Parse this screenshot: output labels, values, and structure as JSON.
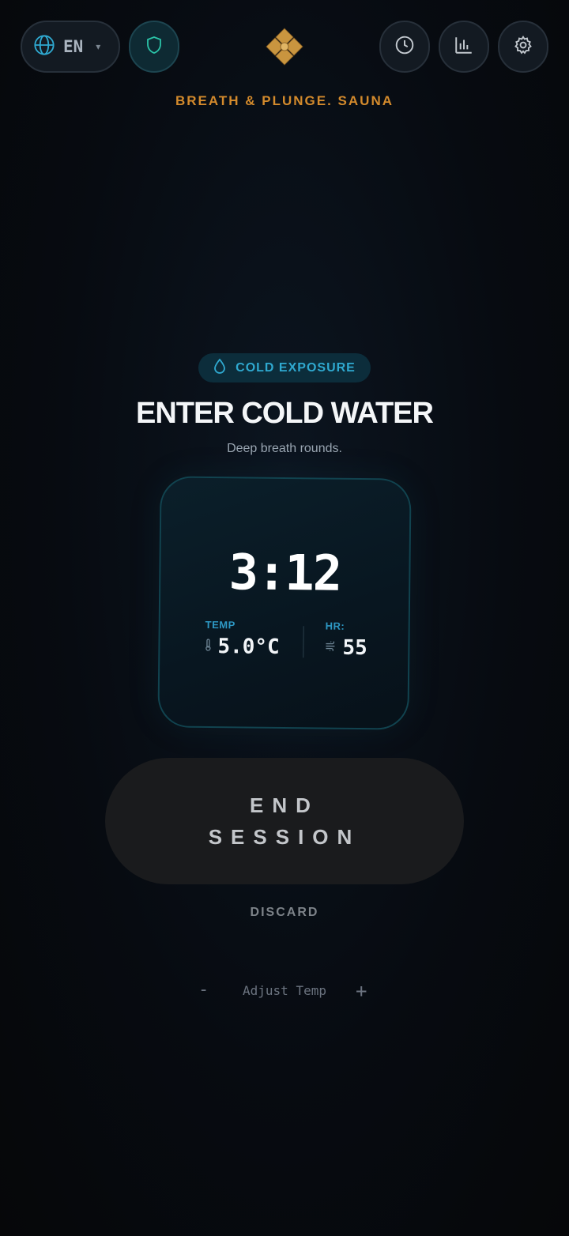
{
  "header": {
    "language": {
      "code": "EN",
      "icon": "globe-icon",
      "caret": "▾"
    },
    "shield_icon": "shield-icon",
    "logo_icon": "ornate-logo",
    "history_icon": "clock-icon",
    "stats_icon": "bar-chart-icon",
    "settings_icon": "gear-icon"
  },
  "subtitle": "BREATH & PLUNGE. SAUNA",
  "phase": {
    "badge_icon": "droplet-icon",
    "badge_label": "COLD EXPOSURE",
    "title": "ENTER COLD WATER",
    "description": "Deep breath rounds."
  },
  "timer_card": {
    "time": "3:12",
    "temp": {
      "label": "TEMP",
      "icon": "thermometer-icon",
      "value": "5.0°C"
    },
    "hr": {
      "label": "HR:",
      "icon": "wind-icon",
      "value": "55"
    }
  },
  "actions": {
    "end_line1": "END",
    "end_line2": "SESSION",
    "discard": "DISCARD"
  },
  "adjust": {
    "minus": "-",
    "label": "Adjust Temp",
    "plus": "+"
  },
  "colors": {
    "accent_gold": "#d38a2c",
    "accent_cyan": "#2fa9d0",
    "background": "#070b11"
  }
}
